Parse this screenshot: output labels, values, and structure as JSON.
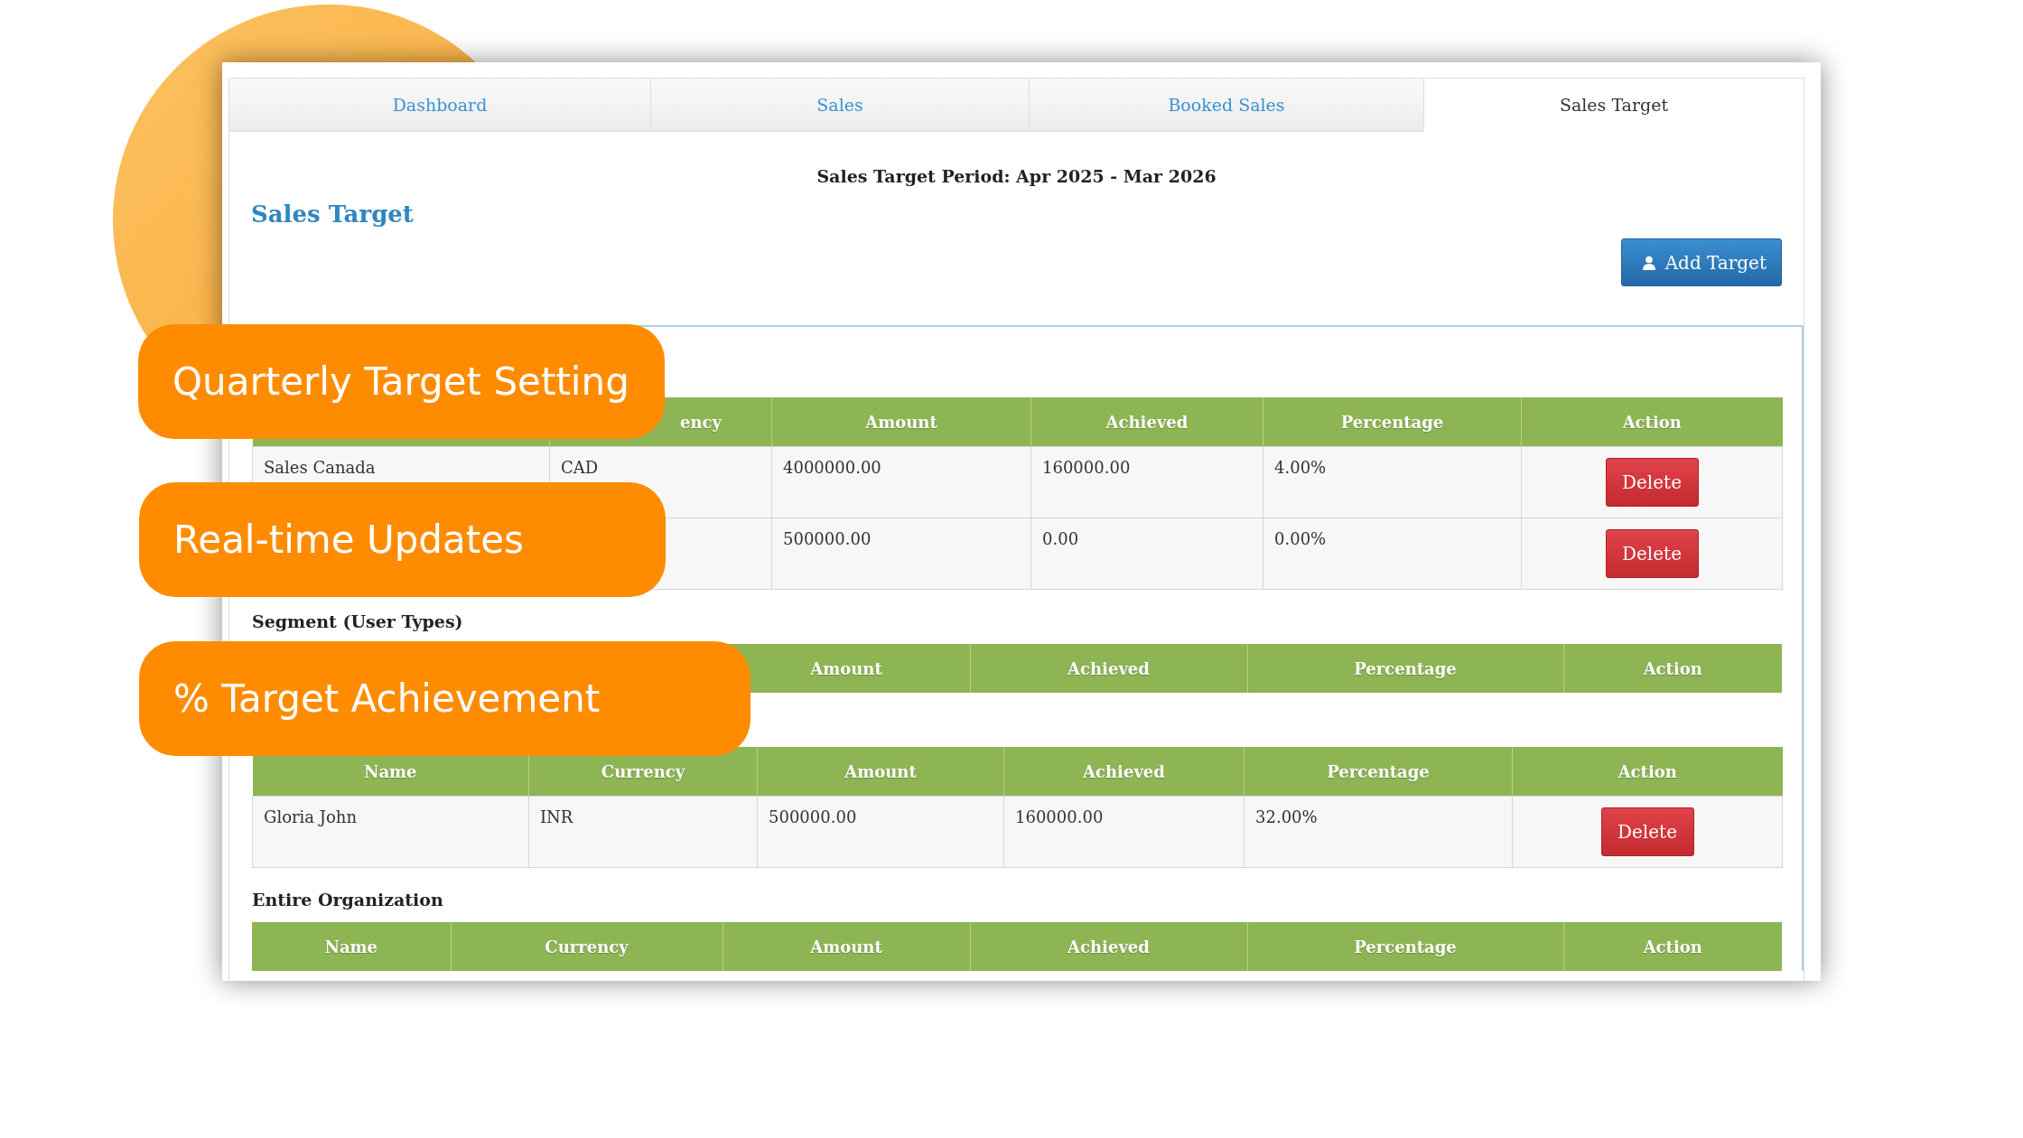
{
  "tabs": [
    {
      "label": "Dashboard",
      "selected": false
    },
    {
      "label": "Sales",
      "selected": false
    },
    {
      "label": "Booked Sales",
      "selected": false
    },
    {
      "label": "Sales Target",
      "selected": true
    }
  ],
  "period": "Sales Target Period: Apr 2025 - Mar 2026",
  "heading": "Sales Target",
  "add_button": "Add Target",
  "sections": [
    {
      "columns": [
        "",
        "ency",
        "Amount",
        "Achieved",
        "Percentage",
        "Action"
      ],
      "rows": [
        {
          "cells": [
            "Sales Canada",
            "CAD",
            "4000000.00",
            "160000.00",
            "4.00%"
          ],
          "action": "Delete"
        },
        {
          "cells": [
            "",
            "",
            "500000.00",
            "0.00",
            "0.00%"
          ],
          "action": "Delete"
        }
      ]
    },
    {
      "title": "Segment (User Types)",
      "columns": [
        "",
        "",
        "Amount",
        "Achieved",
        "Percentage",
        "Action"
      ]
    },
    {
      "columns": [
        "Name",
        "Currency",
        "Amount",
        "Achieved",
        "Percentage",
        "Action"
      ],
      "rows": [
        {
          "cells": [
            "Gloria John",
            "INR",
            "500000.00",
            "160000.00",
            "32.00%"
          ],
          "action": "Delete"
        }
      ]
    },
    {
      "title": "Entire Organization",
      "columns": [
        "Name",
        "Currency",
        "Amount",
        "Achieved",
        "Percentage",
        "Action"
      ]
    }
  ],
  "callouts": [
    "Quarterly Target Setting",
    "Real-time Updates",
    "% Target Achievement"
  ]
}
